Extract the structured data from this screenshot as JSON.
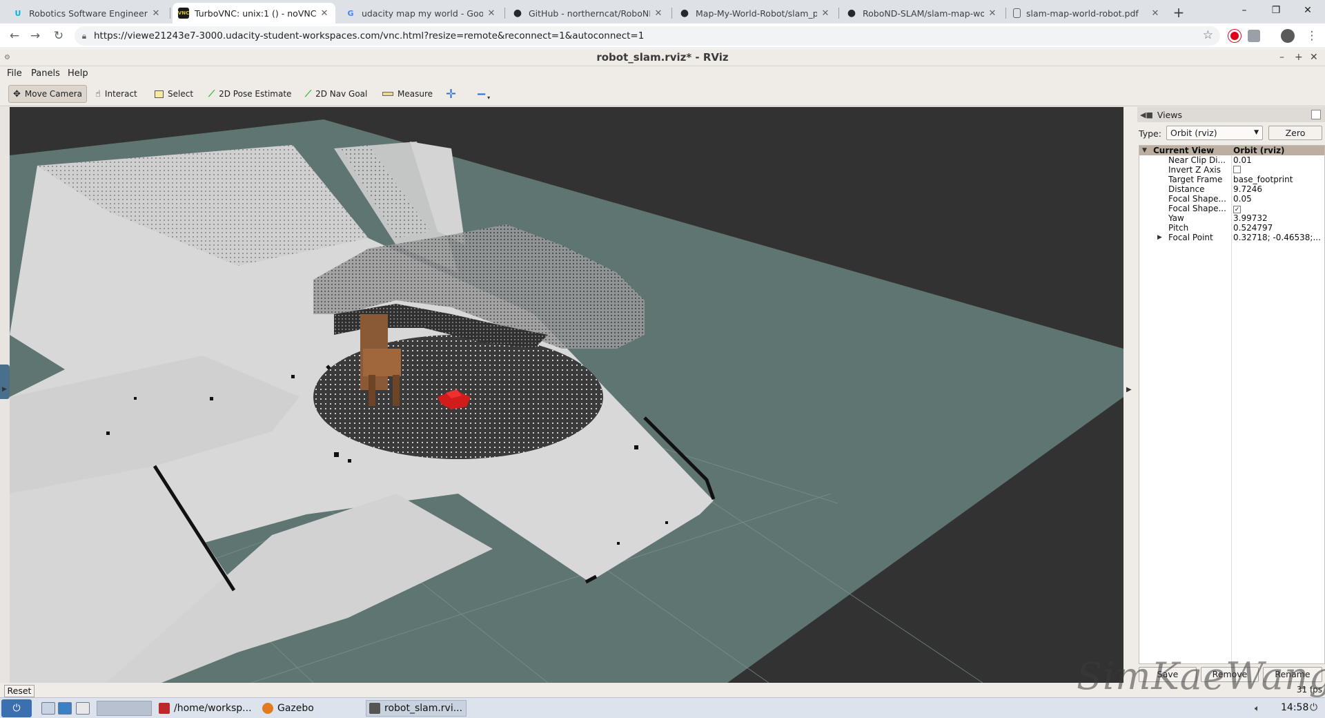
{
  "browser": {
    "tabs": [
      {
        "title": "Robotics Software Engineer - Uda",
        "favicon": "udacity-icon",
        "color": "#02b3e4",
        "glyph": "U"
      },
      {
        "title": "TurboVNC: unix:1 () - noVNC",
        "favicon": "vnc-icon",
        "color": "#1a1a1a",
        "glyph": "V",
        "active": true
      },
      {
        "title": "udacity map my world - Google S",
        "favicon": "google-icon",
        "color": "#4285f4",
        "glyph": "G"
      },
      {
        "title": "GitHub - northerncat/RoboND-M",
        "favicon": "github-icon",
        "color": "#24292e",
        "glyph": "◉"
      },
      {
        "title": "Map-My-World-Robot/slam_proj",
        "favicon": "github-icon",
        "color": "#24292e",
        "glyph": "◉"
      },
      {
        "title": "RoboND-SLAM/slam-map-world",
        "favicon": "github-icon",
        "color": "#24292e",
        "glyph": "◉"
      },
      {
        "title": "slam-map-world-robot.pdf",
        "favicon": "file-icon",
        "color": "#5f6368",
        "glyph": "▯"
      }
    ],
    "url": "https://viewe21243e7-3000.udacity-student-workspaces.com/vnc.html?resize=remote&reconnect=1&autoconnect=1",
    "window_controls": {
      "minimize": "–",
      "maximize": "❐",
      "close": "✕"
    }
  },
  "rviz": {
    "window_title": "robot_slam.rviz* - RViz",
    "menus": [
      "File",
      "Panels",
      "Help"
    ],
    "tools": [
      {
        "label": "Move Camera",
        "icon": "move-camera-icon",
        "glyph": "✥",
        "selected": true
      },
      {
        "label": "Interact",
        "icon": "hand-icon",
        "glyph": "☝"
      },
      {
        "label": "Select",
        "icon": "select-box-icon",
        "glyph": "⬚"
      },
      {
        "label": "2D Pose Estimate",
        "icon": "pose-arrow-icon",
        "glyph": "⟋",
        "color": "#2db82d"
      },
      {
        "label": "2D Nav Goal",
        "icon": "nav-arrow-icon",
        "glyph": "⟋",
        "color": "#2db82d"
      },
      {
        "label": "Measure",
        "icon": "ruler-icon",
        "glyph": "▭"
      }
    ],
    "views_panel": {
      "title": "Views",
      "type_label": "Type:",
      "type_value": "Orbit (rviz)",
      "zero_label": "Zero",
      "current_view": {
        "label": "Current View",
        "value": "Orbit (rviz)"
      },
      "properties": [
        {
          "key": "Near Clip Di...",
          "value": "0.01"
        },
        {
          "key": "Invert Z Axis",
          "value": "",
          "checkbox": false
        },
        {
          "key": "Target Frame",
          "value": "base_footprint"
        },
        {
          "key": "Distance",
          "value": "9.7246"
        },
        {
          "key": "Focal Shape...",
          "value": "0.05"
        },
        {
          "key": "Focal Shape...",
          "value": "",
          "checkbox": true
        },
        {
          "key": "Yaw",
          "value": "3.99732"
        },
        {
          "key": "Pitch",
          "value": "0.524797"
        },
        {
          "key": "Focal Point",
          "value": "0.32718; -0.46538;...",
          "expandable": true
        }
      ],
      "buttons": [
        "Save",
        "Remove",
        "Rename"
      ]
    },
    "reset_label": "Reset",
    "fps": "31 fps"
  },
  "taskbar": {
    "items": [
      {
        "label": "/home/worksp...",
        "icon": "terminal-icon",
        "color": "#c0272d"
      },
      {
        "label": "Gazebo",
        "icon": "gazebo-icon",
        "color": "#e07b20"
      },
      {
        "label": "robot_slam.rvi...",
        "icon": "rviz-icon",
        "color": "#555555"
      }
    ],
    "clock": "14:58"
  },
  "watermark": "SimKaeWang"
}
